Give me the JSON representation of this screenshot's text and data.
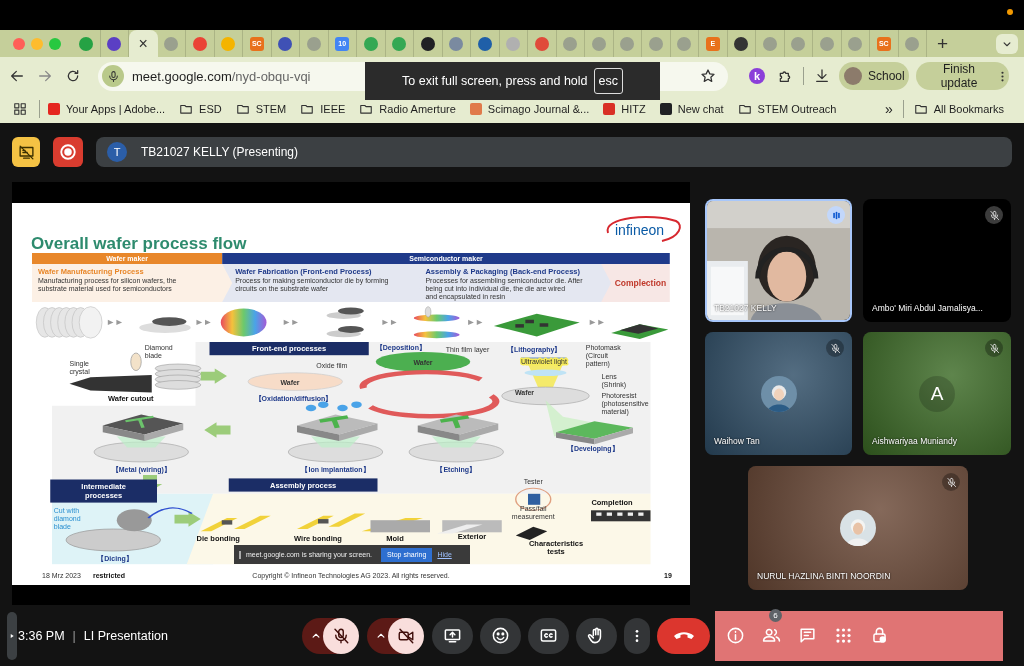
{
  "browser": {
    "tabs": [
      {
        "color": "#25a244",
        "selected": false
      },
      {
        "color": "#5b3fc4",
        "selected": false
      },
      {
        "close": "×",
        "selected": true
      },
      {
        "color": "#9aa08e",
        "selected": false
      },
      {
        "color": "#ea4335",
        "selected": false
      },
      {
        "color": "#f4b400",
        "selected": false
      },
      {
        "color": "#e8711c",
        "text": "SC",
        "selected": false
      },
      {
        "color": "#3f51b5",
        "selected": false
      },
      {
        "color": "#9aa08e",
        "selected": false
      },
      {
        "color": "#4285f4",
        "text": "10",
        "selected": false
      },
      {
        "color": "#34a853",
        "selected": false
      },
      {
        "color": "#34a853",
        "selected": false
      },
      {
        "color": "#202124",
        "selected": false
      },
      {
        "color": "#7a8aa0",
        "selected": false
      },
      {
        "color": "#1f5fa8",
        "selected": false
      },
      {
        "color": "#b0b0b0",
        "selected": false
      },
      {
        "color": "#e04a3a",
        "selected": false
      },
      {
        "color": "#9aa08e",
        "selected": false
      },
      {
        "color": "#9aa08e",
        "selected": false
      },
      {
        "color": "#9aa08e",
        "selected": false
      },
      {
        "color": "#9aa08e",
        "selected": false
      },
      {
        "color": "#9aa08e",
        "selected": false
      },
      {
        "color": "#e8711c",
        "text": "E",
        "selected": false
      },
      {
        "color": "#333333",
        "selected": false
      },
      {
        "color": "#9aa08e",
        "selected": false
      },
      {
        "color": "#9aa08e",
        "selected": false
      },
      {
        "color": "#9aa08e",
        "selected": false
      },
      {
        "color": "#9aa08e",
        "selected": false
      },
      {
        "color": "#e8711c",
        "text": "SC",
        "selected": false
      },
      {
        "color": "#9aa08e",
        "selected": false
      }
    ],
    "new_tab": "+",
    "address": {
      "host": "meet.google.com",
      "path": "/nyd-obqu-vqi"
    },
    "fullscreen_notice": {
      "text": "To exit full screen, press and hold",
      "key": "esc"
    },
    "extension_badge": "k",
    "profile": "School",
    "update_button": "Finish update",
    "bookmarks": [
      {
        "kind": "site",
        "color": "#e5261f",
        "label": "Your Apps | Adobe..."
      },
      {
        "kind": "folder",
        "label": "ESD"
      },
      {
        "kind": "folder",
        "label": "STEM"
      },
      {
        "kind": "folder",
        "label": "IEEE"
      },
      {
        "kind": "folder",
        "label": "Radio Amerture"
      },
      {
        "kind": "site",
        "color": "#e07a4a",
        "label": "Scimago Journal &..."
      },
      {
        "kind": "site",
        "color": "#d93025",
        "label": "HITZ"
      },
      {
        "kind": "site",
        "color": "#202124",
        "label": "New chat"
      },
      {
        "kind": "folder",
        "label": "STEM Outreach"
      }
    ],
    "bookmarks_more": "»",
    "all_bookmarks": "All Bookmarks"
  },
  "meet": {
    "presenter": {
      "initial": "T",
      "label": "TB21027 KELLY (Presenting)"
    },
    "slide": {
      "title": "Overall wafer process flow",
      "logo": "infineon",
      "bands": [
        {
          "label": "Wafer maker",
          "color": "#e8872a"
        },
        {
          "label": "Semiconductor maker",
          "color": "#1f3a8a"
        }
      ],
      "steps": [
        {
          "title": "Wafer Manufacturing Process",
          "text": "Manufacturing process for silicon wafers, the substrate material used for semiconductors",
          "color": "#e8872a"
        },
        {
          "title": "Wafer Fabrication (Front-end Process)",
          "text": "Process for making semiconductor die by forming circuits on the substrate wafer",
          "color": "#1f3a8a"
        },
        {
          "title": "Assembly & Packaging (Back-end Process)",
          "text": "Processes for assembling semiconductor die. After being cut into individual die, the die are wired and encapsulated in resin",
          "color": "#1f3a8a"
        },
        {
          "title": "Complection",
          "color": "#c0392b"
        }
      ],
      "diagram_labels": [
        {
          "kind": "heading",
          "text": "Front-end processes"
        },
        {
          "kind": "step",
          "text": "【Deposition】"
        },
        {
          "kind": "note",
          "text": "Thin film layer"
        },
        {
          "kind": "wafer",
          "text": "Wafer"
        },
        {
          "kind": "step",
          "text": "【Lithography】"
        },
        {
          "kind": "note",
          "text": "Ultraviolet light"
        },
        {
          "kind": "note",
          "text": "Photomask (Circuit pattern)"
        },
        {
          "kind": "note",
          "text": "Lens (Shrink)"
        },
        {
          "kind": "wafer",
          "text": "Wafer"
        },
        {
          "kind": "note",
          "text": "Photoresist (photosensitive material)"
        },
        {
          "kind": "note",
          "text": "Diamond blade"
        },
        {
          "kind": "note",
          "text": "Single crystal"
        },
        {
          "kind": "caption",
          "text": "Wafer cutout"
        },
        {
          "kind": "note",
          "text": "Oxide film"
        },
        {
          "kind": "wafer",
          "text": "Wafer"
        },
        {
          "kind": "step",
          "text": "【Oxidation/diffusion】"
        },
        {
          "kind": "step",
          "text": "【Metal (wiring)】"
        },
        {
          "kind": "step",
          "text": "【Ion implantation】"
        },
        {
          "kind": "step",
          "text": "【Etching】"
        },
        {
          "kind": "step",
          "text": "【Developing】"
        },
        {
          "kind": "heading",
          "text": "Intermediate processes"
        },
        {
          "kind": "heading",
          "text": "Assembly process"
        },
        {
          "kind": "hint",
          "text": "Cut with diamond blade"
        },
        {
          "kind": "step",
          "text": "【Dicing】"
        },
        {
          "kind": "caption",
          "text": "Die bonding"
        },
        {
          "kind": "caption",
          "text": "Wire bonding"
        },
        {
          "kind": "caption",
          "text": "Mold"
        },
        {
          "kind": "caption",
          "text": "Exterior"
        },
        {
          "kind": "note",
          "text": "Tester"
        },
        {
          "kind": "note",
          "text": "Pass/fail measurement"
        },
        {
          "kind": "caption",
          "text": "Completion"
        },
        {
          "kind": "caption",
          "text": "Characteristics tests"
        }
      ],
      "footer": {
        "date": "18 Mrz 2023",
        "classification": "restricted",
        "copyright": "Copyright © Infineon Technologies AG 2023. All rights reserved.",
        "page": "19"
      }
    },
    "share_notice": {
      "text": "meet.google.com is sharing your screen.",
      "stop": "Stop sharing",
      "hide": "Hide"
    },
    "tiles": [
      {
        "kind": "video",
        "name": "TB21027 KELLY",
        "speaking": true,
        "muted": false
      },
      {
        "kind": "blank",
        "name": "Ambo' Miri Abdul Jamalisya...",
        "speaking": false,
        "muted": true
      },
      {
        "name": "Waihow Tan",
        "color": "#2e4d66",
        "speaking": false,
        "muted": true
      },
      {
        "kind": "initial",
        "name": "Aishwariyaa Muniandy",
        "initial": "A",
        "color": "#3b6a25",
        "speaking": false,
        "muted": true
      },
      {
        "name": "NURUL HAZLINA BINTI NOORDIN",
        "color": "#6a4836",
        "speaking": false,
        "muted": true
      }
    ],
    "time": "3:36 PM",
    "separator": "|",
    "meeting_title": "LI Presentation",
    "controls": [
      {
        "kind": "mic",
        "on": false
      },
      {
        "kind": "camera",
        "on": false
      },
      {
        "kind": "present"
      },
      {
        "kind": "reactions"
      },
      {
        "kind": "captions"
      },
      {
        "kind": "hand"
      },
      {
        "kind": "more"
      },
      {
        "kind": "leave"
      }
    ],
    "side_controls": [
      {
        "kind": "info"
      },
      {
        "kind": "people",
        "badge": "6"
      },
      {
        "kind": "chat"
      },
      {
        "kind": "activities"
      },
      {
        "kind": "host"
      }
    ]
  }
}
